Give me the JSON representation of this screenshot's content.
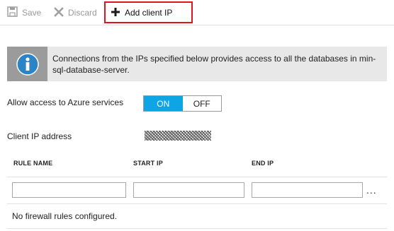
{
  "toolbar": {
    "save_label": "Save",
    "discard_label": "Discard",
    "add_client_ip_label": "Add client IP",
    "highlight_color": "#e0141e"
  },
  "info_banner": {
    "text": "Connections from the IPs specified below provides access to all the databases in min-sql-database-server.",
    "icon": "info-icon"
  },
  "azure_access": {
    "label": "Allow access to Azure services",
    "on_label": "ON",
    "off_label": "OFF",
    "selected": "ON",
    "accent_color": "#0ea5e4"
  },
  "client_ip": {
    "label": "Client IP address",
    "value_redacted": true
  },
  "rules_table": {
    "columns": [
      "RULE NAME",
      "START IP",
      "END IP"
    ],
    "new_row": {
      "rule_name": "",
      "start_ip": "",
      "end_ip": ""
    },
    "more_label": "...",
    "empty_message": "No firewall rules configured."
  }
}
